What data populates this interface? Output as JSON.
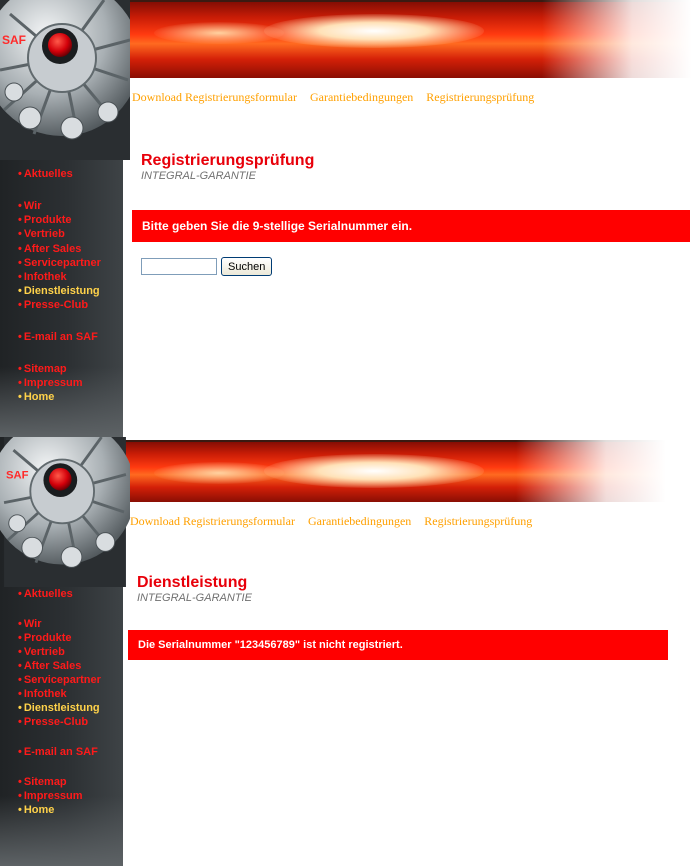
{
  "nav": {
    "download": "Download Registrierungsformular",
    "garantie": "Garantiebedingungen",
    "pruefung": "Registrierungsprüfung"
  },
  "logo": "SAF",
  "bullet": "•",
  "menu": {
    "aktuelles": "Aktuelles",
    "wir": "Wir",
    "produkte": "Produkte",
    "vertrieb": "Vertrieb",
    "after_sales": "After Sales",
    "servicepartner": "Servicepartner",
    "infothek": "Infothek",
    "dienstleistung": "Dienstleistung",
    "presse_club": "Presse-Club",
    "email": "E-mail an SAF",
    "sitemap": "Sitemap",
    "impressum": "Impressum",
    "home": "Home"
  },
  "panel1": {
    "title": "Registrierungsprüfung",
    "subtitle": "INTEGRAL-GARANTIE",
    "message": "Bitte geben Sie die 9-stellige Serialnummer ein.",
    "search_value": "",
    "search_button": "Suchen"
  },
  "panel2": {
    "title": "Dienstleistung",
    "subtitle": "INTEGRAL-GARANTIE",
    "message": "Die Serialnummer \"123456789\" ist nicht registriert."
  },
  "colors": {
    "menu_red": "#ff1a1a",
    "menu_yellow": "#ffd24a",
    "nav_orange": "#ffa000",
    "bar_red": "#ff0000",
    "title_red": "#e8000a"
  }
}
